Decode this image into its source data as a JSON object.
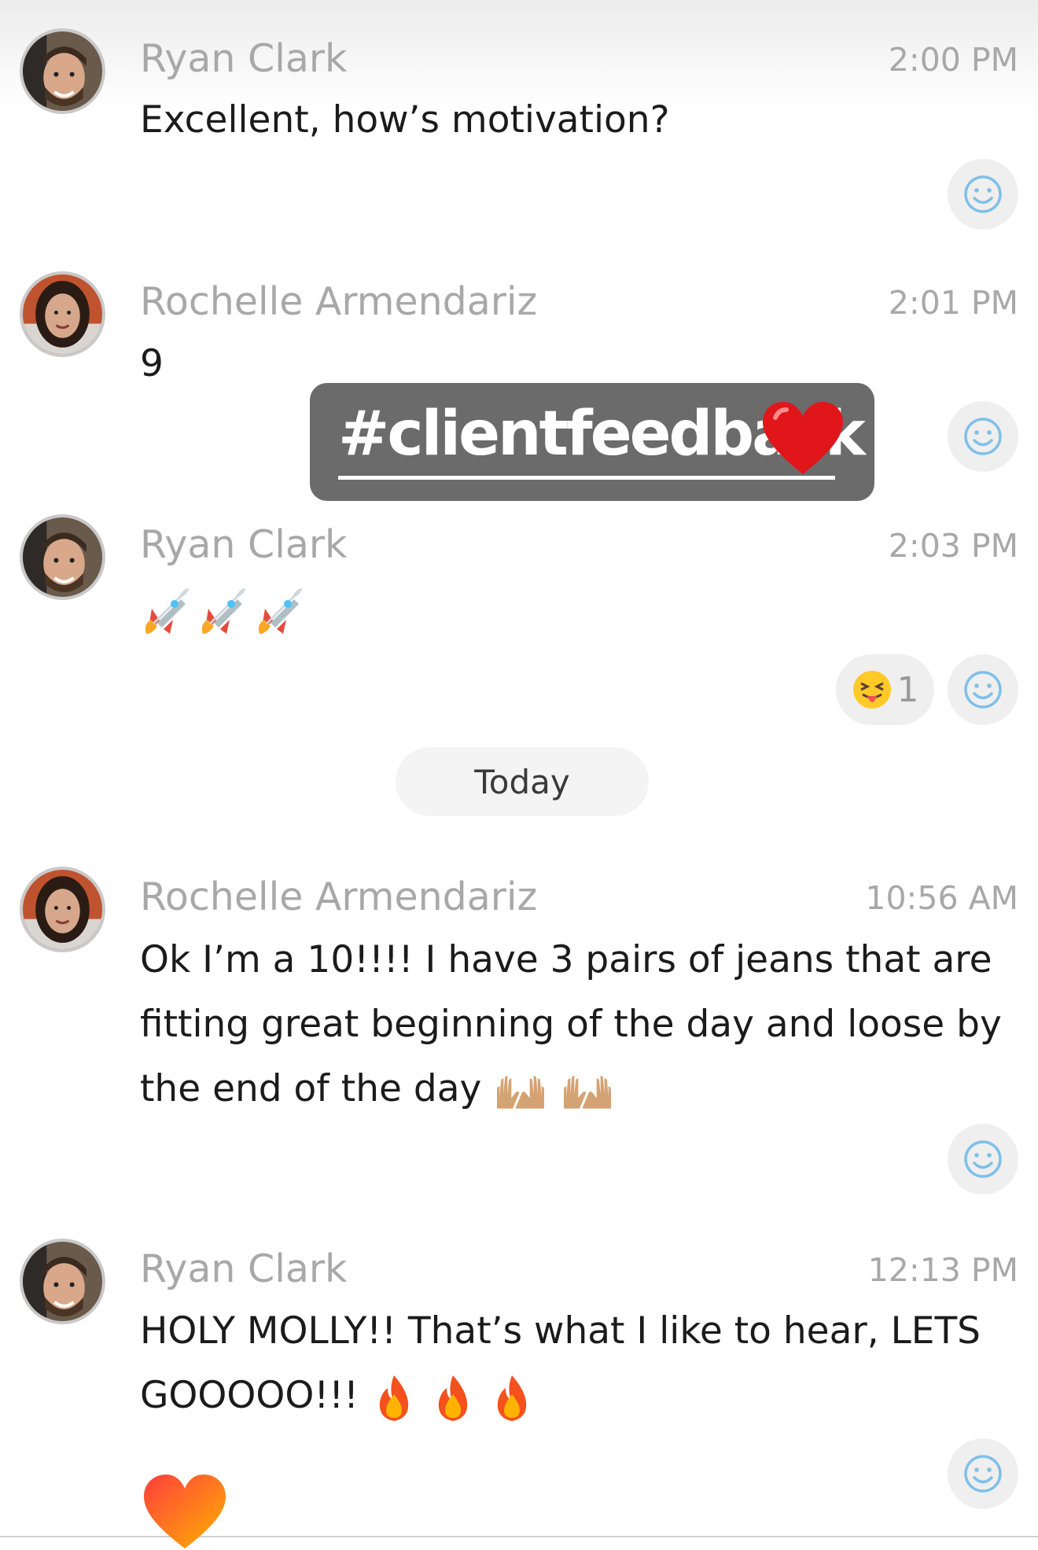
{
  "sticker": {
    "text": "#clientfeedback",
    "heart": "red-heart-emoji"
  },
  "divider": {
    "label": "Today"
  },
  "messages": [
    {
      "sender": "Ryan Clark",
      "time": "2:00 PM",
      "text": "Excellent, how’s motivation?",
      "avatar": "ryan-avatar"
    },
    {
      "sender": "Rochelle Armendariz",
      "time": "2:01 PM",
      "text": "9",
      "avatar": "rochelle-avatar"
    },
    {
      "sender": "Ryan Clark",
      "time": "2:03 PM",
      "text": "",
      "emojis": [
        "rocket",
        "rocket",
        "rocket"
      ],
      "reaction": {
        "emoji": "squinting-tongue-face",
        "count": "1"
      }
    },
    {
      "sender": "Rochelle Armendariz",
      "time": "10:56 AM",
      "line1": "Ok I’m a 10!!!! I have 3 pairs of jeans that are",
      "line2": "fitting great beginning of the day and loose by",
      "line3": "the end of the day",
      "emojis": [
        "raising-hands",
        "raising-hands"
      ]
    },
    {
      "sender": "Ryan Clark",
      "time": "12:13 PM",
      "line1": "HOLY MOLLY!! That’s what I like to hear, LETS",
      "line2": "GOOOOO!!!",
      "emojis": [
        "fire",
        "fire",
        "fire"
      ]
    }
  ],
  "icons": {
    "react": "smiley-add-reaction-icon"
  },
  "colors": {
    "smiley_stroke": "#7ec0e8",
    "sticker_bg": "#6b6b6b",
    "gray_text": "#a8a8a8"
  }
}
